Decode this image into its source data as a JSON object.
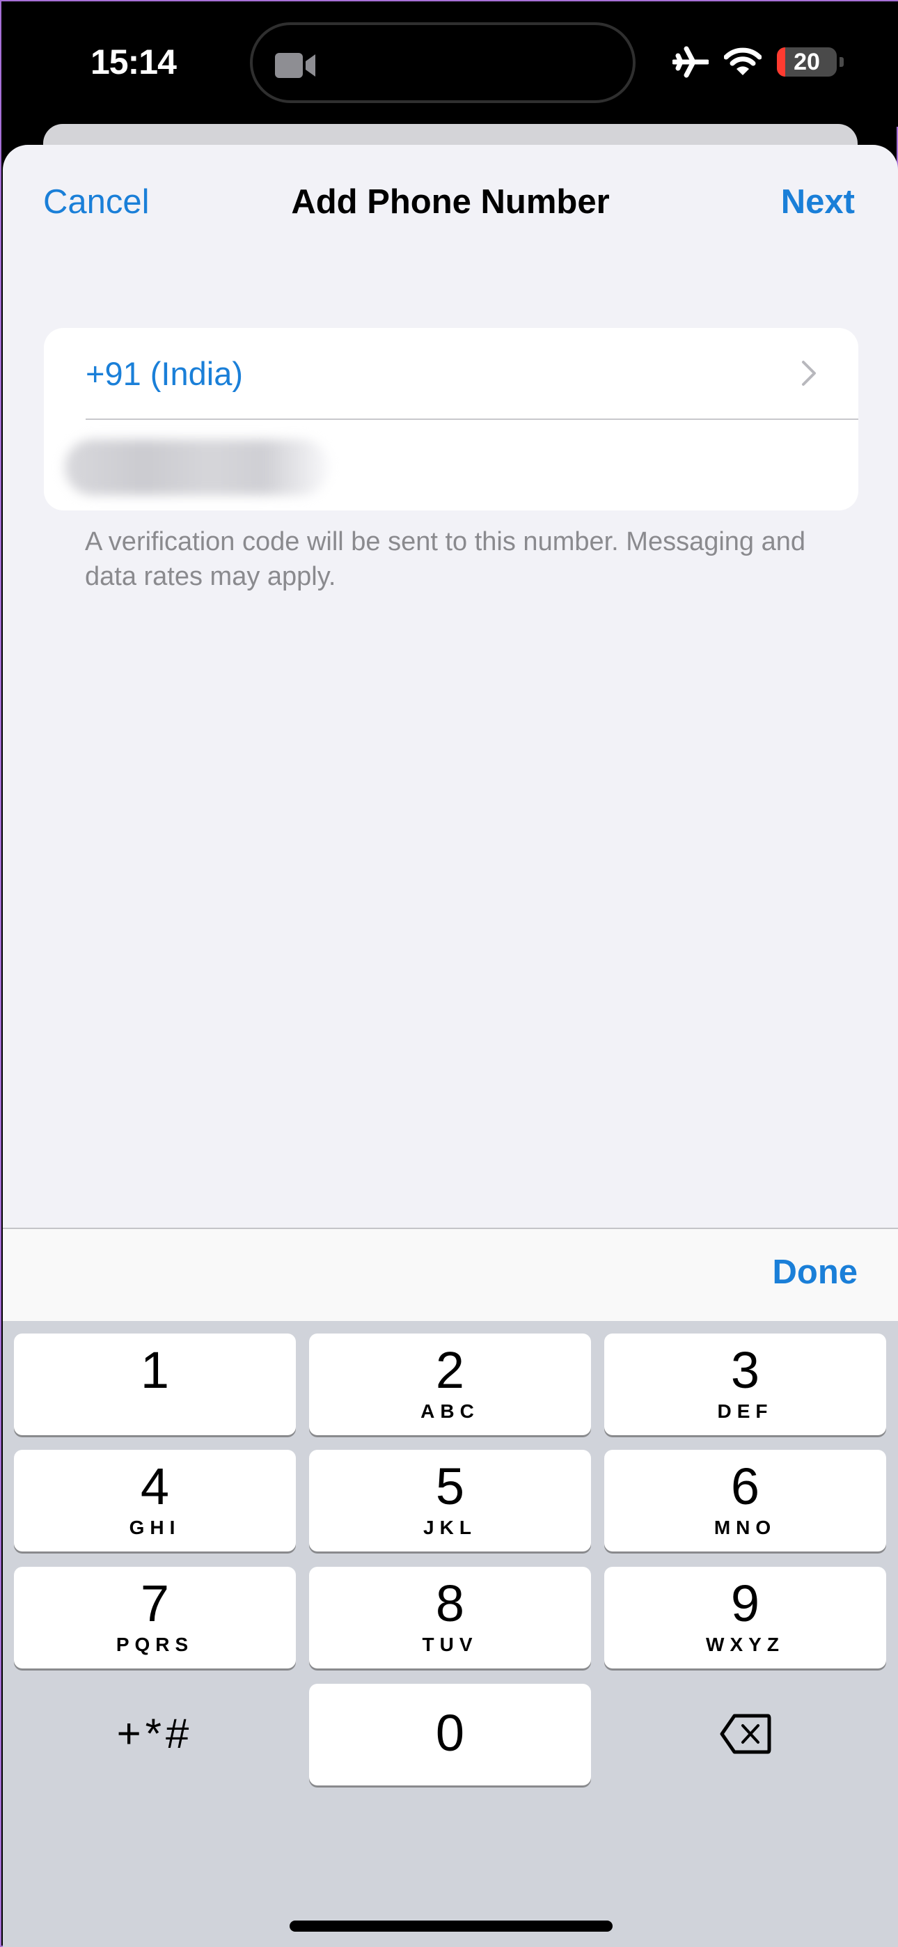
{
  "status_bar": {
    "time": "15:14",
    "battery_percent": 20,
    "battery_label": "20",
    "icons": [
      "video-camera-icon",
      "airplane-mode-icon",
      "wifi-icon",
      "battery-icon"
    ]
  },
  "nav": {
    "cancel_label": "Cancel",
    "title": "Add Phone Number",
    "next_label": "Next"
  },
  "form": {
    "country_label": "+91 (India)",
    "phone_value": "[redacted]",
    "footer_note": "A verification code will be sent to this number. Messaging and data rates may apply."
  },
  "toolbar": {
    "done_label": "Done"
  },
  "keypad": {
    "keys": [
      {
        "digit": "1",
        "letters": ""
      },
      {
        "digit": "2",
        "letters": "ABC"
      },
      {
        "digit": "3",
        "letters": "DEF"
      },
      {
        "digit": "4",
        "letters": "GHI"
      },
      {
        "digit": "5",
        "letters": "JKL"
      },
      {
        "digit": "6",
        "letters": "MNO"
      },
      {
        "digit": "7",
        "letters": "PQRS"
      },
      {
        "digit": "8",
        "letters": "TUV"
      },
      {
        "digit": "9",
        "letters": "WXYZ"
      },
      {
        "digit": "0",
        "letters": ""
      }
    ],
    "symbols_label": "+*#"
  },
  "colors": {
    "accent": "#1a7fd8",
    "sheet_bg": "#f2f2f7",
    "keyboard_bg": "#d0d3da",
    "battery_low": "#ff3b30"
  }
}
